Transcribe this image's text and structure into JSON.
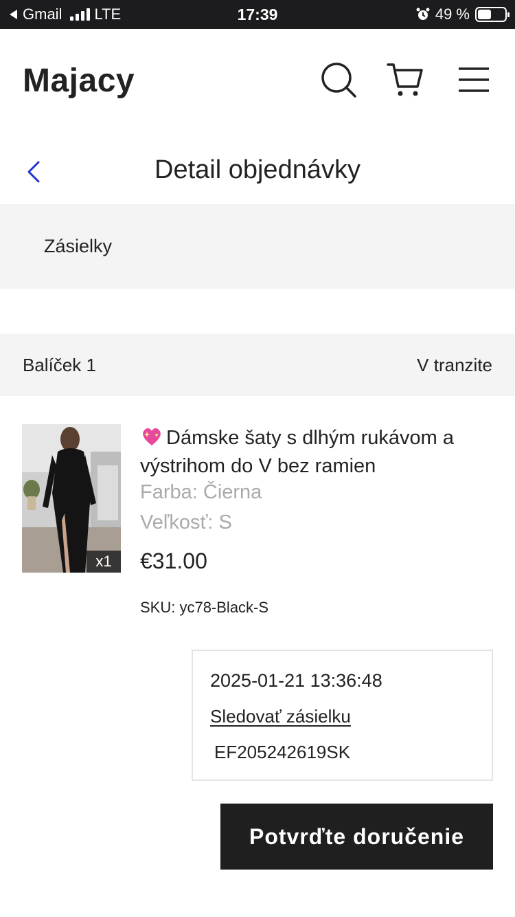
{
  "status_bar": {
    "back_app": "Gmail",
    "network": "LTE",
    "time": "17:39",
    "battery_percent": "49 %",
    "battery_level": 0.49
  },
  "header": {
    "logo": "Majacy",
    "icons": [
      "search-icon",
      "cart-icon",
      "menu-icon"
    ]
  },
  "page": {
    "title": "Detail objednávky"
  },
  "shipments": {
    "label": "Zásielky"
  },
  "package": {
    "label": "Balíček 1",
    "status": "V tranzite"
  },
  "product": {
    "name": "Dámske šaty s dlhým rukávom a výstrihom do V bez ramien",
    "name_icon": "sparkling-heart-emoji",
    "color": "Farba: Čierna",
    "size": "Veľkosť: S",
    "price": "€31.00",
    "sku": "SKU: yc78-Black-S",
    "quantity": "x1"
  },
  "tracking": {
    "datetime": "2025-01-21 13:36:48",
    "link_label": "Sledovať zásielku",
    "tracking_number": "EF205242619SK"
  },
  "actions": {
    "confirm_label": "Potvrďte doručenie"
  },
  "colors": {
    "accent_back_chevron": "#2233cc",
    "button_bg": "#1f1f1f",
    "muted_text": "#aaaaaa",
    "panel_bg": "#f4f4f4"
  }
}
